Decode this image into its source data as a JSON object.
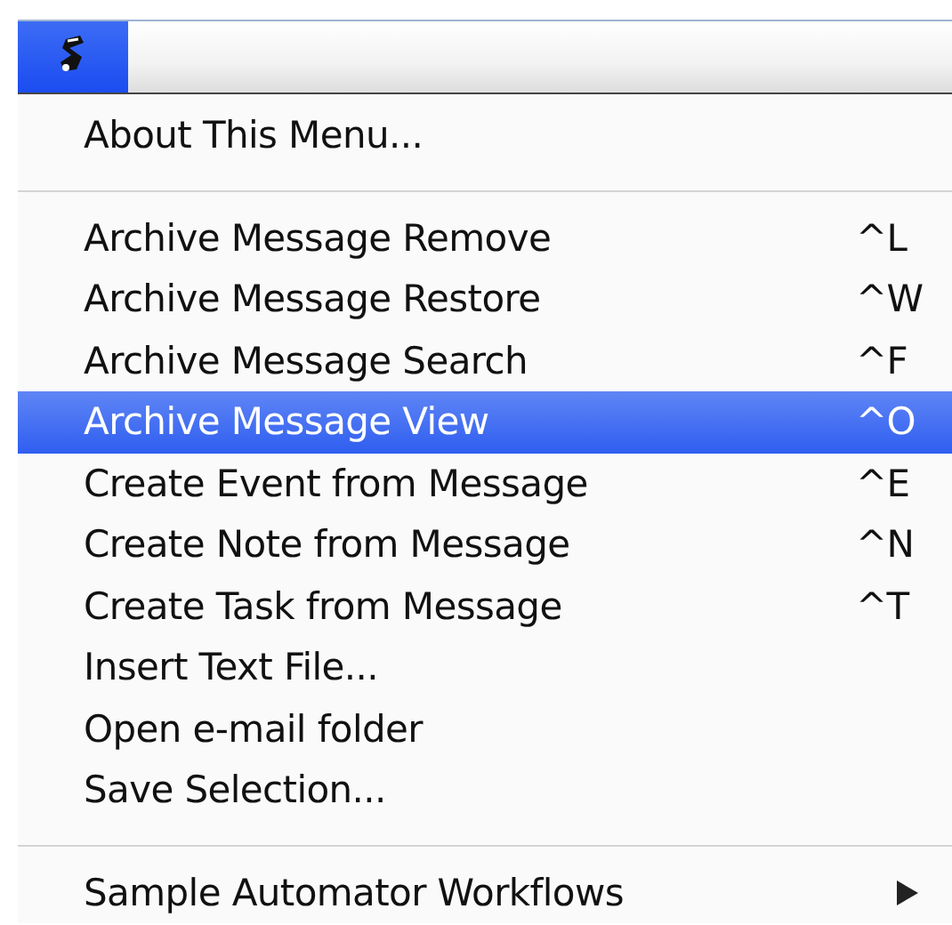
{
  "menu_bar": {
    "items": [
      {
        "kind": "script-icon",
        "selected": true
      }
    ]
  },
  "menu": {
    "sections": [
      {
        "items": [
          {
            "label": "About This Menu...",
            "selected": false
          }
        ]
      },
      {
        "items": [
          {
            "label": "Archive Message Remove",
            "shortcut": "^L",
            "selected": false
          },
          {
            "label": "Archive Message Restore",
            "shortcut": "^W",
            "selected": false
          },
          {
            "label": "Archive Message Search",
            "shortcut": "^F",
            "selected": false
          },
          {
            "label": "Archive Message View",
            "shortcut": "^O",
            "selected": true
          },
          {
            "label": "Create Event from Message",
            "shortcut": "^E",
            "selected": false
          },
          {
            "label": "Create Note from Message",
            "shortcut": "^N",
            "selected": false
          },
          {
            "label": "Create Task from Message",
            "shortcut": "^T",
            "selected": false
          },
          {
            "label": "Insert Text File...",
            "selected": false
          },
          {
            "label": "Open e-mail folder",
            "selected": false
          },
          {
            "label": "Save Selection...",
            "selected": false
          }
        ]
      },
      {
        "items": [
          {
            "label": "Sample Automator Workflows",
            "selected": false,
            "submenu": true
          }
        ]
      }
    ]
  }
}
